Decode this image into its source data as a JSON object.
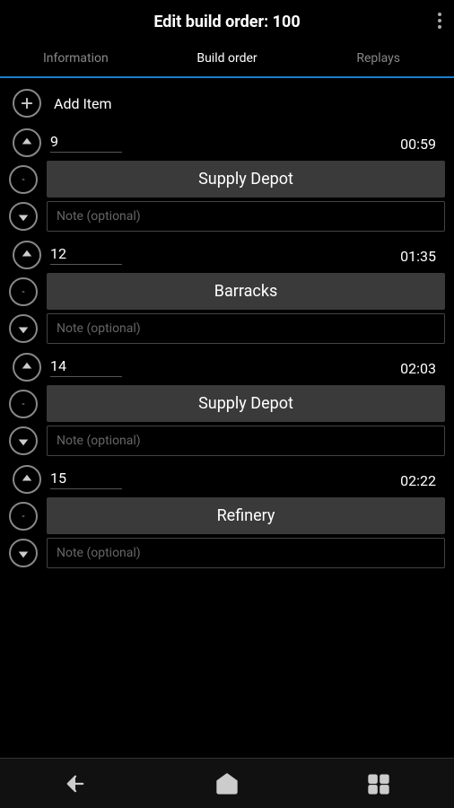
{
  "header": {
    "title_prefix": "Edit build order: ",
    "title_number": "100",
    "menu_icon": "more-vertical-icon"
  },
  "tabs": [
    {
      "label": "Information",
      "active": false
    },
    {
      "label": "Build order",
      "active": true
    },
    {
      "label": "Replays",
      "active": false
    }
  ],
  "add_item": {
    "label": "Add Item",
    "icon": "add-icon"
  },
  "build_items": [
    {
      "supply": "9",
      "time": "00:59",
      "building": "Supply Depot",
      "note_placeholder": "Note (optional)"
    },
    {
      "supply": "12",
      "time": "01:35",
      "building": "Barracks",
      "note_placeholder": "Note (optional)"
    },
    {
      "supply": "14",
      "time": "02:03",
      "building": "Supply Depot",
      "note_placeholder": "Note (optional)"
    },
    {
      "supply": "15",
      "time": "02:22",
      "building": "Refinery",
      "note_placeholder": "Note (optional)"
    }
  ],
  "bottom_nav": {
    "back_icon": "back-icon",
    "home_icon": "home-icon",
    "recents_icon": "recents-icon"
  }
}
